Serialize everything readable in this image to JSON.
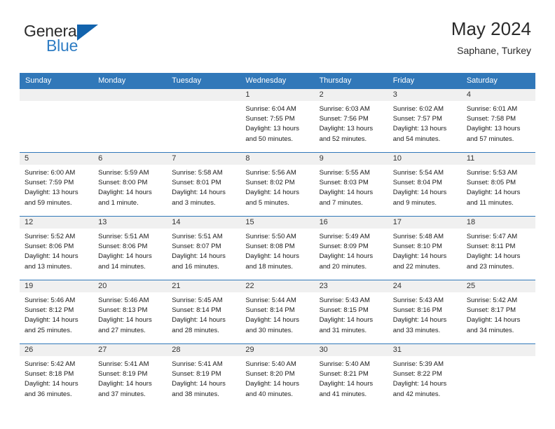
{
  "brand": {
    "name_part1": "General",
    "name_part2": "Blue",
    "triangle_color": "#1263ad",
    "blue_color": "#2f7dc4"
  },
  "header": {
    "title": "May 2024",
    "subtitle": "Saphane, Turkey"
  },
  "theme": {
    "header_row_bg": "#3178b9",
    "header_row_text": "#ffffff",
    "daynum_bg": "#f0f0f0",
    "grid_line": "#3178b9"
  },
  "weekday_headers": [
    "Sunday",
    "Monday",
    "Tuesday",
    "Wednesday",
    "Thursday",
    "Friday",
    "Saturday"
  ],
  "weeks": [
    [
      {
        "day": "",
        "lines": []
      },
      {
        "day": "",
        "lines": []
      },
      {
        "day": "",
        "lines": []
      },
      {
        "day": "1",
        "lines": [
          "Sunrise: 6:04 AM",
          "Sunset: 7:55 PM",
          "Daylight: 13 hours",
          "and 50 minutes."
        ]
      },
      {
        "day": "2",
        "lines": [
          "Sunrise: 6:03 AM",
          "Sunset: 7:56 PM",
          "Daylight: 13 hours",
          "and 52 minutes."
        ]
      },
      {
        "day": "3",
        "lines": [
          "Sunrise: 6:02 AM",
          "Sunset: 7:57 PM",
          "Daylight: 13 hours",
          "and 54 minutes."
        ]
      },
      {
        "day": "4",
        "lines": [
          "Sunrise: 6:01 AM",
          "Sunset: 7:58 PM",
          "Daylight: 13 hours",
          "and 57 minutes."
        ]
      }
    ],
    [
      {
        "day": "5",
        "lines": [
          "Sunrise: 6:00 AM",
          "Sunset: 7:59 PM",
          "Daylight: 13 hours",
          "and 59 minutes."
        ]
      },
      {
        "day": "6",
        "lines": [
          "Sunrise: 5:59 AM",
          "Sunset: 8:00 PM",
          "Daylight: 14 hours",
          "and 1 minute."
        ]
      },
      {
        "day": "7",
        "lines": [
          "Sunrise: 5:58 AM",
          "Sunset: 8:01 PM",
          "Daylight: 14 hours",
          "and 3 minutes."
        ]
      },
      {
        "day": "8",
        "lines": [
          "Sunrise: 5:56 AM",
          "Sunset: 8:02 PM",
          "Daylight: 14 hours",
          "and 5 minutes."
        ]
      },
      {
        "day": "9",
        "lines": [
          "Sunrise: 5:55 AM",
          "Sunset: 8:03 PM",
          "Daylight: 14 hours",
          "and 7 minutes."
        ]
      },
      {
        "day": "10",
        "lines": [
          "Sunrise: 5:54 AM",
          "Sunset: 8:04 PM",
          "Daylight: 14 hours",
          "and 9 minutes."
        ]
      },
      {
        "day": "11",
        "lines": [
          "Sunrise: 5:53 AM",
          "Sunset: 8:05 PM",
          "Daylight: 14 hours",
          "and 11 minutes."
        ]
      }
    ],
    [
      {
        "day": "12",
        "lines": [
          "Sunrise: 5:52 AM",
          "Sunset: 8:06 PM",
          "Daylight: 14 hours",
          "and 13 minutes."
        ]
      },
      {
        "day": "13",
        "lines": [
          "Sunrise: 5:51 AM",
          "Sunset: 8:06 PM",
          "Daylight: 14 hours",
          "and 14 minutes."
        ]
      },
      {
        "day": "14",
        "lines": [
          "Sunrise: 5:51 AM",
          "Sunset: 8:07 PM",
          "Daylight: 14 hours",
          "and 16 minutes."
        ]
      },
      {
        "day": "15",
        "lines": [
          "Sunrise: 5:50 AM",
          "Sunset: 8:08 PM",
          "Daylight: 14 hours",
          "and 18 minutes."
        ]
      },
      {
        "day": "16",
        "lines": [
          "Sunrise: 5:49 AM",
          "Sunset: 8:09 PM",
          "Daylight: 14 hours",
          "and 20 minutes."
        ]
      },
      {
        "day": "17",
        "lines": [
          "Sunrise: 5:48 AM",
          "Sunset: 8:10 PM",
          "Daylight: 14 hours",
          "and 22 minutes."
        ]
      },
      {
        "day": "18",
        "lines": [
          "Sunrise: 5:47 AM",
          "Sunset: 8:11 PM",
          "Daylight: 14 hours",
          "and 23 minutes."
        ]
      }
    ],
    [
      {
        "day": "19",
        "lines": [
          "Sunrise: 5:46 AM",
          "Sunset: 8:12 PM",
          "Daylight: 14 hours",
          "and 25 minutes."
        ]
      },
      {
        "day": "20",
        "lines": [
          "Sunrise: 5:46 AM",
          "Sunset: 8:13 PM",
          "Daylight: 14 hours",
          "and 27 minutes."
        ]
      },
      {
        "day": "21",
        "lines": [
          "Sunrise: 5:45 AM",
          "Sunset: 8:14 PM",
          "Daylight: 14 hours",
          "and 28 minutes."
        ]
      },
      {
        "day": "22",
        "lines": [
          "Sunrise: 5:44 AM",
          "Sunset: 8:14 PM",
          "Daylight: 14 hours",
          "and 30 minutes."
        ]
      },
      {
        "day": "23",
        "lines": [
          "Sunrise: 5:43 AM",
          "Sunset: 8:15 PM",
          "Daylight: 14 hours",
          "and 31 minutes."
        ]
      },
      {
        "day": "24",
        "lines": [
          "Sunrise: 5:43 AM",
          "Sunset: 8:16 PM",
          "Daylight: 14 hours",
          "and 33 minutes."
        ]
      },
      {
        "day": "25",
        "lines": [
          "Sunrise: 5:42 AM",
          "Sunset: 8:17 PM",
          "Daylight: 14 hours",
          "and 34 minutes."
        ]
      }
    ],
    [
      {
        "day": "26",
        "lines": [
          "Sunrise: 5:42 AM",
          "Sunset: 8:18 PM",
          "Daylight: 14 hours",
          "and 36 minutes."
        ]
      },
      {
        "day": "27",
        "lines": [
          "Sunrise: 5:41 AM",
          "Sunset: 8:19 PM",
          "Daylight: 14 hours",
          "and 37 minutes."
        ]
      },
      {
        "day": "28",
        "lines": [
          "Sunrise: 5:41 AM",
          "Sunset: 8:19 PM",
          "Daylight: 14 hours",
          "and 38 minutes."
        ]
      },
      {
        "day": "29",
        "lines": [
          "Sunrise: 5:40 AM",
          "Sunset: 8:20 PM",
          "Daylight: 14 hours",
          "and 40 minutes."
        ]
      },
      {
        "day": "30",
        "lines": [
          "Sunrise: 5:40 AM",
          "Sunset: 8:21 PM",
          "Daylight: 14 hours",
          "and 41 minutes."
        ]
      },
      {
        "day": "31",
        "lines": [
          "Sunrise: 5:39 AM",
          "Sunset: 8:22 PM",
          "Daylight: 14 hours",
          "and 42 minutes."
        ]
      },
      {
        "day": "",
        "lines": []
      }
    ]
  ]
}
